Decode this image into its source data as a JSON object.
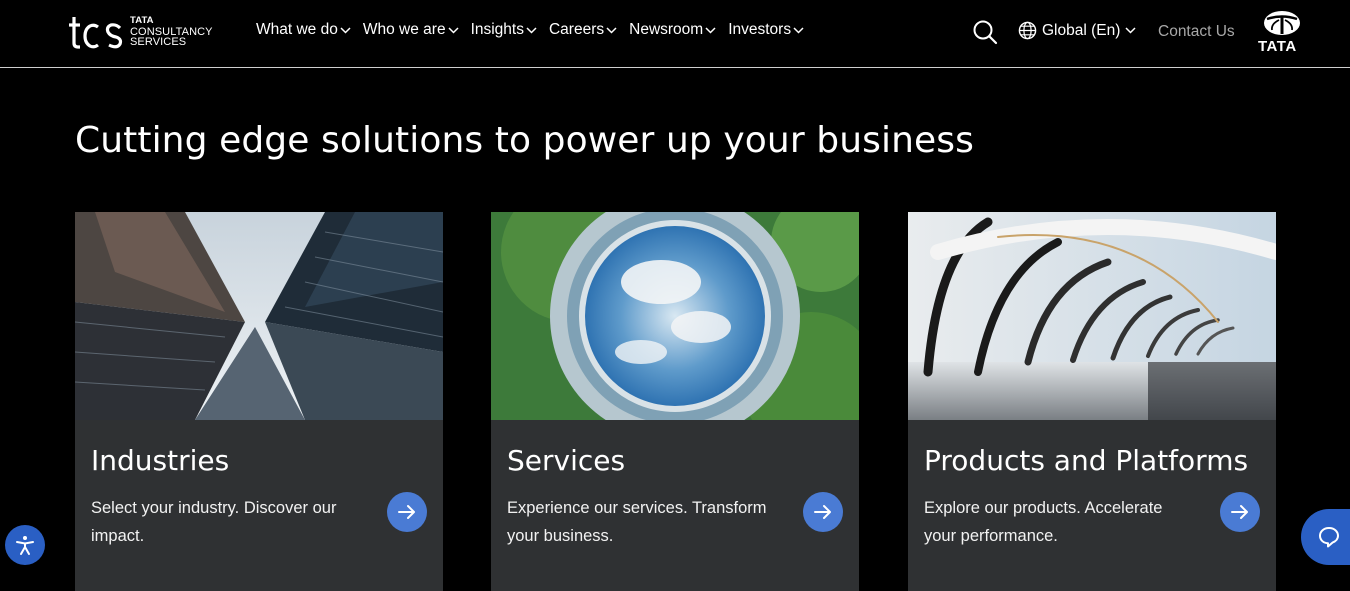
{
  "header": {
    "logo": {
      "line1": "TATA",
      "line2": "CONSULTANCY",
      "line3": "SERVICES"
    },
    "nav": [
      {
        "label": "What we do"
      },
      {
        "label": "Who we are"
      },
      {
        "label": "Insights"
      },
      {
        "label": "Careers"
      },
      {
        "label": "Newsroom"
      },
      {
        "label": "Investors"
      }
    ],
    "language": "Global (En)",
    "contact": "Contact Us",
    "brand": "TATA"
  },
  "main": {
    "headline": "Cutting edge solutions to power up your business",
    "cards": [
      {
        "title": "Industries",
        "description": "Select your industry. Discover our impact."
      },
      {
        "title": "Services",
        "description": "Experience our services. Transform your business."
      },
      {
        "title": "Products and Platforms",
        "description": "Explore our products. Accelerate your performance."
      }
    ]
  },
  "colors": {
    "background": "#000000",
    "card": "#2f3133",
    "accent": "#4a7bd4",
    "floating_button": "#2a5fc4",
    "muted_text": "#a8a8a8"
  },
  "icons": [
    "search-icon",
    "globe-icon",
    "chevron-down-icon",
    "arrow-right-icon",
    "accessibility-icon",
    "chat-icon"
  ]
}
